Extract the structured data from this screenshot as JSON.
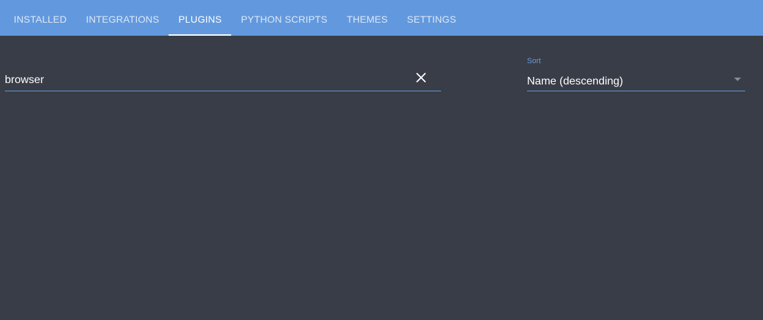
{
  "tabs": [
    {
      "label": "INSTALLED"
    },
    {
      "label": "INTEGRATIONS"
    },
    {
      "label": "PLUGINS",
      "active": true
    },
    {
      "label": "PYTHON SCRIPTS"
    },
    {
      "label": "THEMES"
    },
    {
      "label": "SETTINGS"
    }
  ],
  "search": {
    "value": "browser",
    "clear_icon": "close-icon"
  },
  "sort": {
    "label": "Sort",
    "value": "Name (descending)",
    "icon": "caret-down-icon"
  },
  "colors": {
    "header": "#6299de",
    "background": "#393d47",
    "accent": "#6a9ad8"
  }
}
